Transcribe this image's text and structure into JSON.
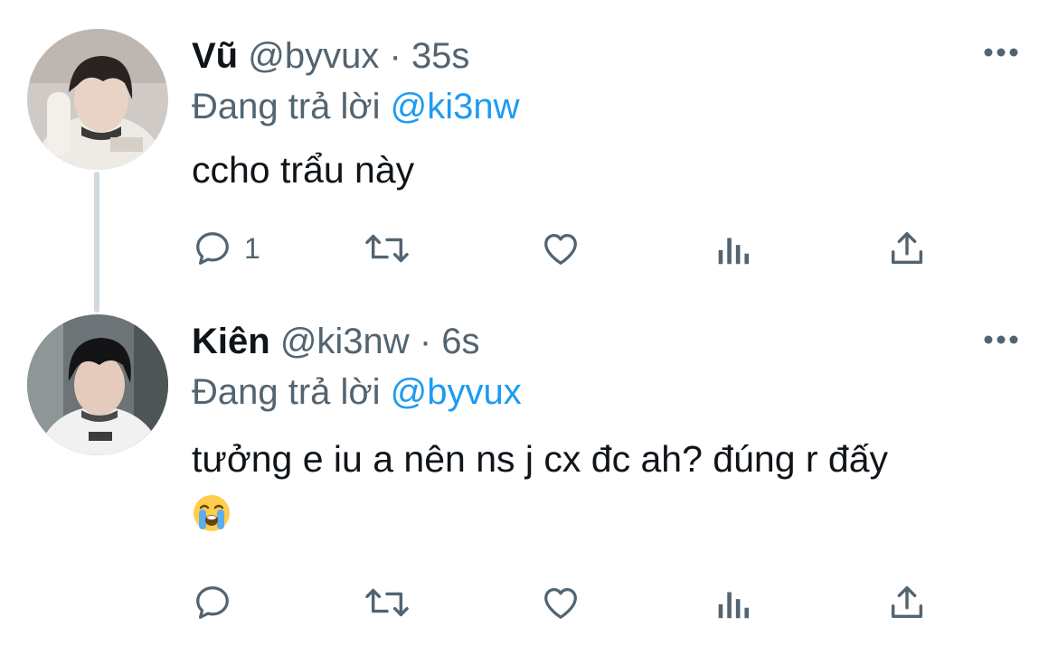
{
  "tweets": [
    {
      "display_name": "Vũ",
      "handle": "@byvux",
      "separator": "·",
      "time": "35s",
      "reply_prefix": "Đang trả lời",
      "reply_to": "@ki3nw",
      "text": "ccho trẩu này",
      "emoji": "",
      "reply_count": "1"
    },
    {
      "display_name": "Kiên",
      "handle": "@ki3nw",
      "separator": "·",
      "time": "6s",
      "reply_prefix": "Đang trả lời",
      "reply_to": "@byvux",
      "text": "tưởng e iu a nên ns j cx đc ah? đúng r đấy",
      "emoji": "loudly-crying-face",
      "reply_count": ""
    }
  ],
  "icons": [
    "more-icon",
    "reply-icon",
    "retweet-icon",
    "like-icon",
    "analytics-icon",
    "share-icon"
  ],
  "colors": {
    "text": "#0f1419",
    "secondary": "#536471",
    "link": "#1d9bf0",
    "thread_line": "#cfd9de"
  }
}
